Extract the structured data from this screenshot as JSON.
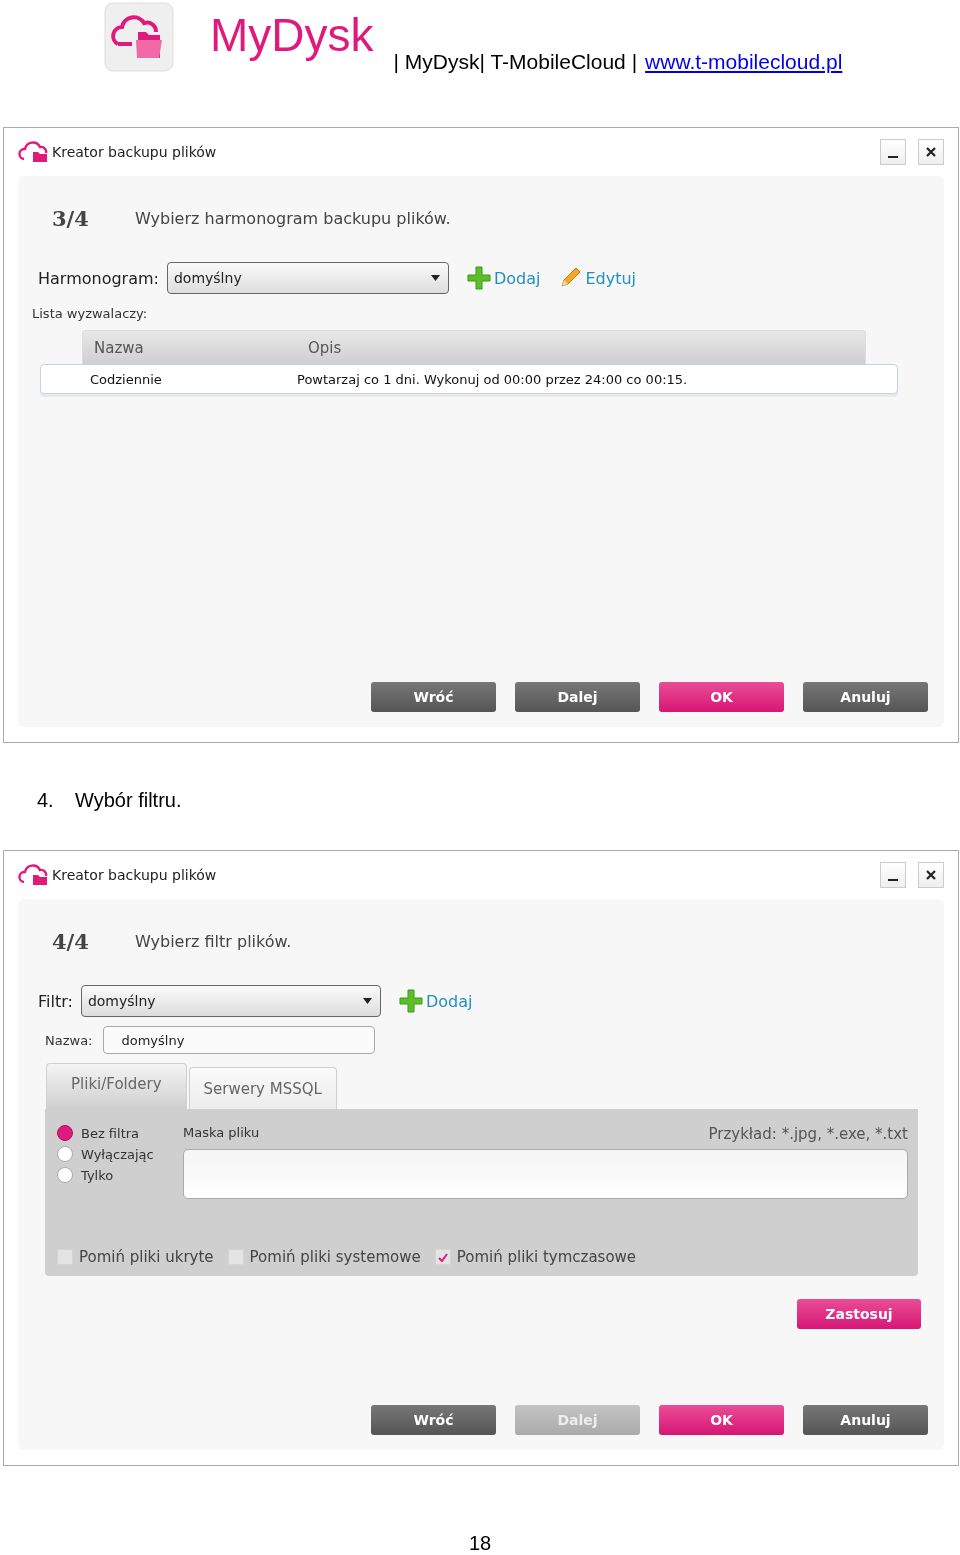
{
  "header": {
    "app_name": "MyDysk",
    "breadcrumb": "| MyDysk| T-MobileCloud |",
    "link": "www.t-mobilecloud.pl"
  },
  "windows": [
    {
      "kind": "schedule",
      "title": "Kreator backupu plików",
      "step": "3/4",
      "instruction": "Wybierz harmonogram backupu plików.",
      "selector": {
        "label": "Harmonogram:",
        "value": "domyślny"
      },
      "actions": [
        {
          "kind": "add",
          "label": "Dodaj"
        },
        {
          "kind": "edit",
          "label": "Edytuj"
        }
      ],
      "list_label": "Lista wyzwalaczy:",
      "table": {
        "columns": [
          "Nazwa",
          "Opis"
        ],
        "rows": [
          [
            "Codziennie",
            "Powtarzaj co 1 dni. Wykonuj od 00:00 przez 24:00 co 00:15."
          ]
        ]
      },
      "buttons": [
        {
          "label": "Wróć",
          "kind": "dark",
          "disabled": false
        },
        {
          "label": "Dalej",
          "kind": "dark",
          "disabled": false
        },
        {
          "label": "OK",
          "kind": "primary",
          "disabled": false
        },
        {
          "label": "Anuluj",
          "kind": "dark",
          "disabled": false
        }
      ]
    },
    {
      "kind": "filter",
      "title": "Kreator backupu plików",
      "step": "4/4",
      "instruction": "Wybierz filtr plików.",
      "selector": {
        "label": "Filtr:",
        "value": "domyślny"
      },
      "actions": [
        {
          "kind": "add",
          "label": "Dodaj"
        }
      ],
      "name_field": {
        "label": "Nazwa:",
        "value": "domyślny"
      },
      "tabs": [
        {
          "label": "Pliki/Foldery",
          "selected": true
        },
        {
          "label": "Serwery MSSQL",
          "selected": false
        }
      ],
      "radios": [
        {
          "label": "Bez filtra",
          "selected": true
        },
        {
          "label": "Wyłączając",
          "selected": false
        },
        {
          "label": "Tylko",
          "selected": false
        }
      ],
      "mask_label": "Maska pliku",
      "example": "Przykład: *.jpg, *.exe, *.txt",
      "checkboxes": [
        {
          "label": "Pomiń pliki ukryte",
          "checked": false
        },
        {
          "label": "Pomiń pliki systemowe",
          "checked": false
        },
        {
          "label": "Pomiń pliki tymczasowe",
          "checked": true
        }
      ],
      "apply_button": "Zastosuj",
      "buttons": [
        {
          "label": "Wróć",
          "kind": "dark",
          "disabled": false
        },
        {
          "label": "Dalej",
          "kind": "dark",
          "disabled": true
        },
        {
          "label": "OK",
          "kind": "primary",
          "disabled": false
        },
        {
          "label": "Anuluj",
          "kind": "dark",
          "disabled": false
        }
      ]
    }
  ],
  "caption": {
    "number": "4.",
    "text": "Wybór filtru."
  },
  "page_number": "18"
}
